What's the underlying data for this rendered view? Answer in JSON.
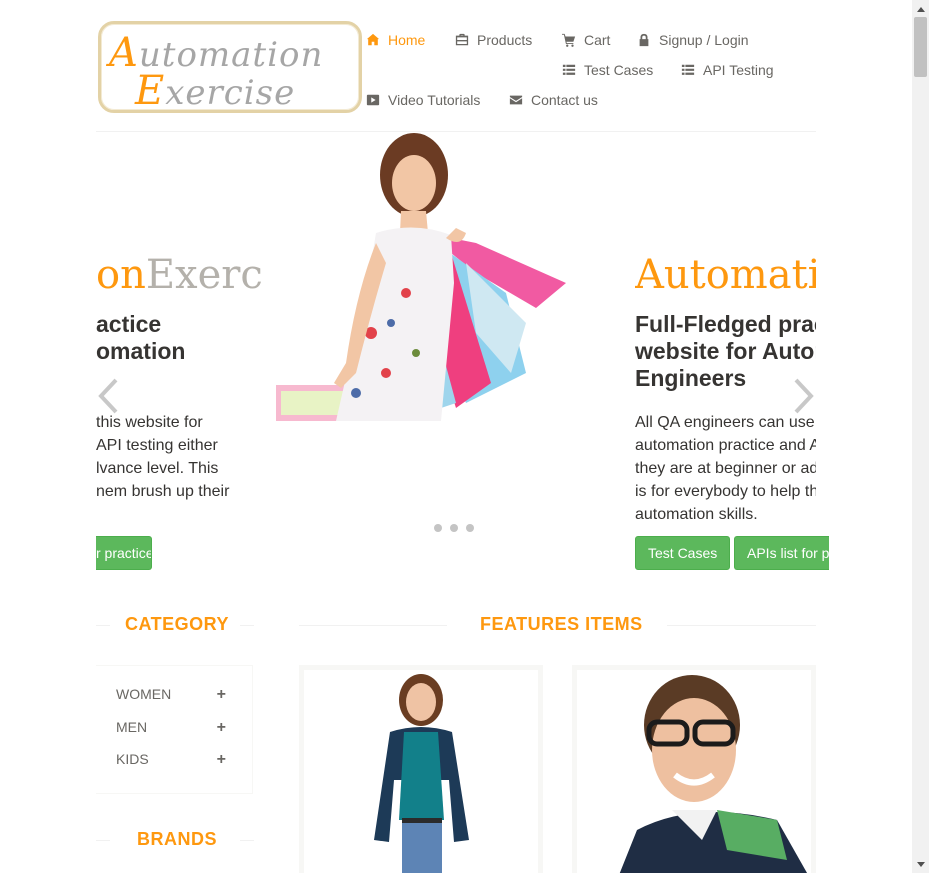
{
  "logo": {
    "line1_cap": "A",
    "line1_rest": "utomation",
    "line2_cap": "E",
    "line2_rest": "xercise"
  },
  "nav": {
    "home": "Home",
    "products": "Products",
    "cart": "Cart",
    "login": "Signup / Login",
    "test_cases": "Test Cases",
    "api_testing": "API Testing",
    "video": "Video Tutorials",
    "contact": "Contact us"
  },
  "slider": {
    "left_title_orange": "on",
    "left_title_gray": "Exercise",
    "left_sub_1": "actice",
    "left_sub_2": "omation",
    "left_text": [
      "this website for",
      "API testing either",
      "lvance level. This",
      "nem brush up their"
    ],
    "left_button": "r practice",
    "right_title": "Automation",
    "right_sub": [
      "Full-Fledged practice",
      "website for Automation",
      "Engineers"
    ],
    "right_text": [
      "All QA engineers can use this website for",
      "automation practice and API testing either",
      "they are at beginner or advance level. This",
      "is for everybody to help them brush up their",
      "automation skills."
    ],
    "btn_test_cases": "Test Cases",
    "btn_apis": "APIs list for practice"
  },
  "sidebar": {
    "category_heading": "CATEGORY",
    "categories": [
      {
        "label": "WOMEN"
      },
      {
        "label": "MEN"
      },
      {
        "label": "KIDS"
      }
    ],
    "brands_heading": "BRANDS"
  },
  "features": {
    "heading": "FEATURES ITEMS"
  },
  "colors": {
    "accent": "#FE980F",
    "green": "#5CB85C",
    "text": "#696763"
  }
}
